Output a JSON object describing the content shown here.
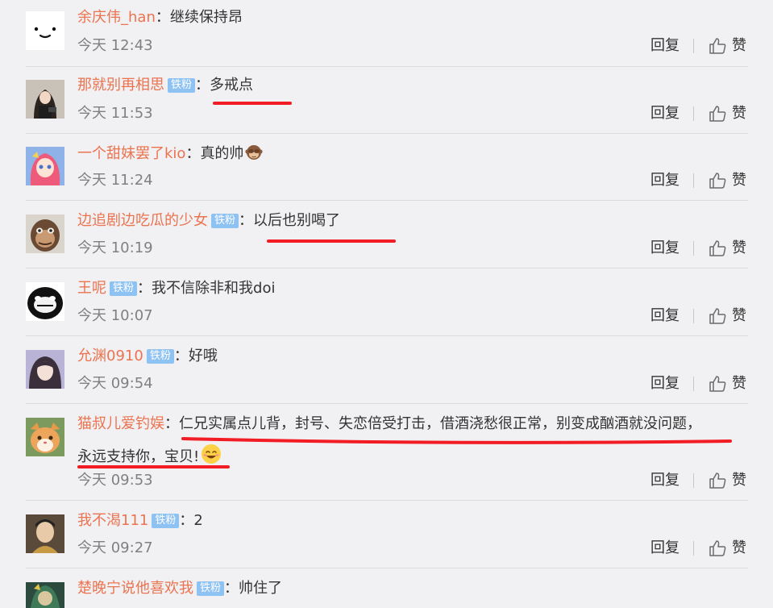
{
  "actions": {
    "reply_label": "回复",
    "like_label": "赞"
  },
  "badge_label": "铁粉",
  "colon": "：",
  "comments": [
    {
      "user": "余庆伟_han",
      "text": "继续保持昂",
      "time": "今天 12:43",
      "fan": false
    },
    {
      "user": "那就别再相思",
      "text": "多戒点",
      "time": "今天 11:53",
      "fan": true
    },
    {
      "user": "一个甜妹罢了kio",
      "text": "真的帅",
      "time": "今天 11:24",
      "fan": false,
      "emoji": "monkey-covering-eyes"
    },
    {
      "user": "边追剧边吃瓜的少女",
      "text": "以后也别喝了",
      "time": "今天 10:19",
      "fan": true
    },
    {
      "user": "王呢",
      "text": "我不信除非和我doi",
      "time": "今天 10:07",
      "fan": true
    },
    {
      "user": "允渊0910",
      "text": "好哦",
      "time": "今天 09:54",
      "fan": true
    },
    {
      "user": "猫叔儿爱钓娱",
      "text": "仁兄实属点儿背，封号、失恋倍受打击，借酒浇愁很正常，别变成酗酒就没问题，",
      "text2": "永远支持你，宝贝!",
      "time": "今天 09:53",
      "fan": false,
      "emoji": "smiling-face"
    },
    {
      "user": "我不渴111",
      "text": "2",
      "time": "今天 09:27",
      "fan": true
    },
    {
      "user": "楚晚宁说他喜欢我",
      "text": "帅住了",
      "fan": true
    }
  ],
  "colors": {
    "username": "#eb7350",
    "badge": "#8ec2f2",
    "underline": "#f21c24",
    "background": "#f1f1f3"
  }
}
